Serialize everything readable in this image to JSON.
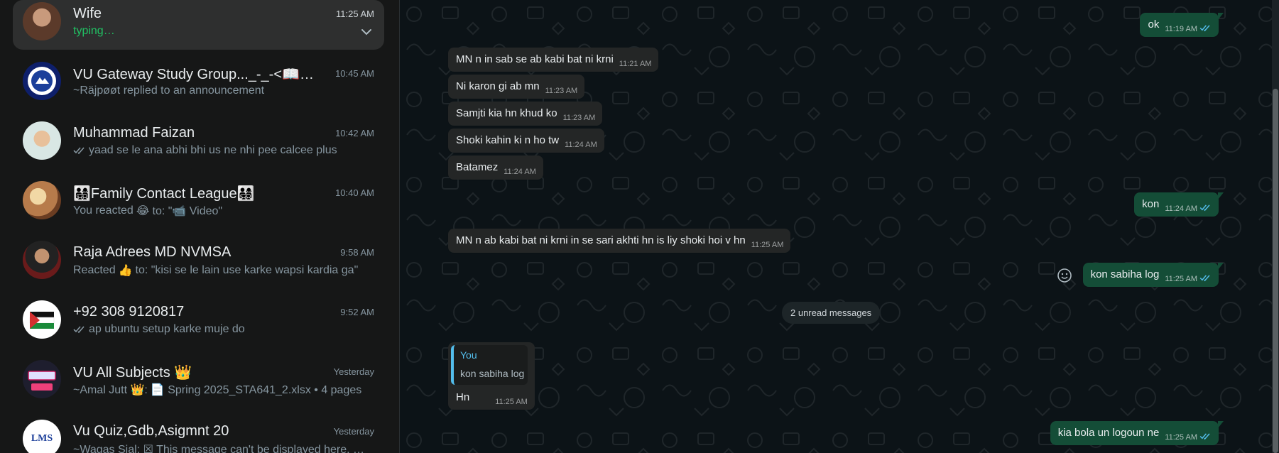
{
  "chats": [
    {
      "name": "Wife",
      "time": "11:25 AM",
      "preview": "typing…",
      "avatar_color": "#7a5a48",
      "active": true
    },
    {
      "name": "VU Gateway Study Group..._-_-<📖🕵️‍♂️✨...",
      "time": "10:45 AM",
      "preview": "~Räjpøøt replied to an announcement",
      "avatar_color": "#1c3f9a"
    },
    {
      "name": "Muhammad Faizan",
      "time": "10:42 AM",
      "preview": "yaad se le ana abhi bhi us ne nhi pee calcee plus",
      "avatar_color": "#e9c4a0"
    },
    {
      "name": "👨‍👩‍👧‍👦Family Contact League👨‍👩‍👧‍👦",
      "time": "10:40 AM",
      "preview_prefix": "You reacted",
      "preview_emoji": "😂",
      "preview": "to: \"📹 Video\"",
      "avatar_color": "#b77b4b"
    },
    {
      "name": "Raja Adrees MD NVMSA",
      "time": "9:58 AM",
      "preview_prefix": "Reacted",
      "preview_emoji": "👍",
      "preview": "to: \"kisi se le lain use karke wapsi kardia ga\"",
      "avatar_color": "#4a1f1f"
    },
    {
      "name": "+92 308 9120817",
      "time": "9:52 AM",
      "preview": "ap ubuntu setup karke muje do",
      "avatar_color": "#ffffff"
    },
    {
      "name": "VU All Subjects 👑",
      "time": "Yesterday",
      "preview_prefix": "~Amal Jutt 👑:",
      "preview": "📄 Spring 2025_STA641_2.xlsx • 4 pages",
      "avatar_color": "#2a1f3f"
    },
    {
      "name": "Vu Quiz,Gdb,Asigmnt 20",
      "time": "Yesterday",
      "preview": "~Waqas Sial: ☒ This message can't be displayed here. Pl...",
      "avatar_color": "#ffffff",
      "avatar_text": "LMS"
    }
  ],
  "messages": [
    {
      "dir": "out",
      "text": "ok",
      "time": "11:19 AM"
    },
    {
      "dir": "in",
      "text": "MN n in sab se ab kabi bat ni krni",
      "time": "11:21 AM"
    },
    {
      "dir": "in",
      "text": "Ni karon gi ab mn",
      "time": "11:23 AM"
    },
    {
      "dir": "in",
      "text": "Samjti kia hn khud ko",
      "time": "11:23 AM"
    },
    {
      "dir": "in",
      "text": "Shoki kahin ki n ho tw",
      "time": "11:24 AM"
    },
    {
      "dir": "in",
      "text": "Batamez",
      "time": "11:24 AM"
    },
    {
      "dir": "out",
      "text": "kon",
      "time": "11:24 AM"
    },
    {
      "dir": "in",
      "text": "MN n ab kabi bat ni krni in se sari akhti hn is liy shoki hoi v hn",
      "time": "11:25 AM"
    },
    {
      "dir": "out",
      "text": "kon sabiha log",
      "time": "11:25 AM"
    },
    {
      "dir": "in",
      "text": "Hn",
      "time": "11:25 AM",
      "quote_author": "You",
      "quote_text": "kon sabiha log"
    },
    {
      "dir": "out",
      "text": "kia bola un logoun ne",
      "time": "11:25 AM"
    }
  ],
  "unread_label": "2 unread messages",
  "colors": {
    "accent_green": "#21c063",
    "outgoing_bubble": "#144d37",
    "incoming_bubble": "#242626",
    "read_ticks": "#53bdeb"
  }
}
